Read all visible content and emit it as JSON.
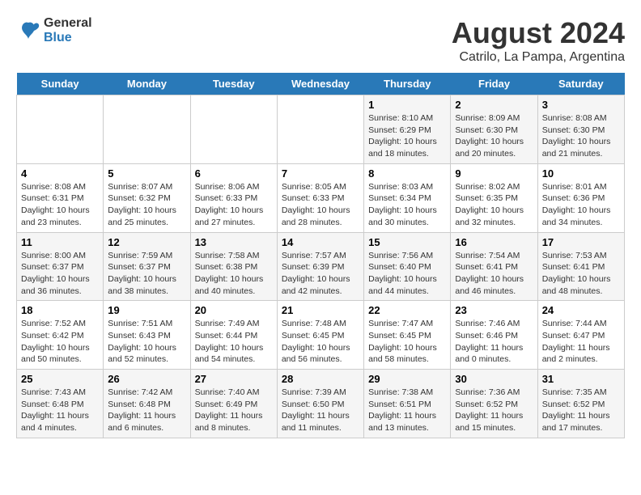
{
  "header": {
    "logo_line1": "General",
    "logo_line2": "Blue",
    "main_title": "August 2024",
    "subtitle": "Catrilo, La Pampa, Argentina"
  },
  "days_of_week": [
    "Sunday",
    "Monday",
    "Tuesday",
    "Wednesday",
    "Thursday",
    "Friday",
    "Saturday"
  ],
  "weeks": [
    [
      {
        "day": "",
        "info": ""
      },
      {
        "day": "",
        "info": ""
      },
      {
        "day": "",
        "info": ""
      },
      {
        "day": "",
        "info": ""
      },
      {
        "day": "1",
        "info": "Sunrise: 8:10 AM\nSunset: 6:29 PM\nDaylight: 10 hours\nand 18 minutes."
      },
      {
        "day": "2",
        "info": "Sunrise: 8:09 AM\nSunset: 6:30 PM\nDaylight: 10 hours\nand 20 minutes."
      },
      {
        "day": "3",
        "info": "Sunrise: 8:08 AM\nSunset: 6:30 PM\nDaylight: 10 hours\nand 21 minutes."
      }
    ],
    [
      {
        "day": "4",
        "info": "Sunrise: 8:08 AM\nSunset: 6:31 PM\nDaylight: 10 hours\nand 23 minutes."
      },
      {
        "day": "5",
        "info": "Sunrise: 8:07 AM\nSunset: 6:32 PM\nDaylight: 10 hours\nand 25 minutes."
      },
      {
        "day": "6",
        "info": "Sunrise: 8:06 AM\nSunset: 6:33 PM\nDaylight: 10 hours\nand 27 minutes."
      },
      {
        "day": "7",
        "info": "Sunrise: 8:05 AM\nSunset: 6:33 PM\nDaylight: 10 hours\nand 28 minutes."
      },
      {
        "day": "8",
        "info": "Sunrise: 8:03 AM\nSunset: 6:34 PM\nDaylight: 10 hours\nand 30 minutes."
      },
      {
        "day": "9",
        "info": "Sunrise: 8:02 AM\nSunset: 6:35 PM\nDaylight: 10 hours\nand 32 minutes."
      },
      {
        "day": "10",
        "info": "Sunrise: 8:01 AM\nSunset: 6:36 PM\nDaylight: 10 hours\nand 34 minutes."
      }
    ],
    [
      {
        "day": "11",
        "info": "Sunrise: 8:00 AM\nSunset: 6:37 PM\nDaylight: 10 hours\nand 36 minutes."
      },
      {
        "day": "12",
        "info": "Sunrise: 7:59 AM\nSunset: 6:37 PM\nDaylight: 10 hours\nand 38 minutes."
      },
      {
        "day": "13",
        "info": "Sunrise: 7:58 AM\nSunset: 6:38 PM\nDaylight: 10 hours\nand 40 minutes."
      },
      {
        "day": "14",
        "info": "Sunrise: 7:57 AM\nSunset: 6:39 PM\nDaylight: 10 hours\nand 42 minutes."
      },
      {
        "day": "15",
        "info": "Sunrise: 7:56 AM\nSunset: 6:40 PM\nDaylight: 10 hours\nand 44 minutes."
      },
      {
        "day": "16",
        "info": "Sunrise: 7:54 AM\nSunset: 6:41 PM\nDaylight: 10 hours\nand 46 minutes."
      },
      {
        "day": "17",
        "info": "Sunrise: 7:53 AM\nSunset: 6:41 PM\nDaylight: 10 hours\nand 48 minutes."
      }
    ],
    [
      {
        "day": "18",
        "info": "Sunrise: 7:52 AM\nSunset: 6:42 PM\nDaylight: 10 hours\nand 50 minutes."
      },
      {
        "day": "19",
        "info": "Sunrise: 7:51 AM\nSunset: 6:43 PM\nDaylight: 10 hours\nand 52 minutes."
      },
      {
        "day": "20",
        "info": "Sunrise: 7:49 AM\nSunset: 6:44 PM\nDaylight: 10 hours\nand 54 minutes."
      },
      {
        "day": "21",
        "info": "Sunrise: 7:48 AM\nSunset: 6:45 PM\nDaylight: 10 hours\nand 56 minutes."
      },
      {
        "day": "22",
        "info": "Sunrise: 7:47 AM\nSunset: 6:45 PM\nDaylight: 10 hours\nand 58 minutes."
      },
      {
        "day": "23",
        "info": "Sunrise: 7:46 AM\nSunset: 6:46 PM\nDaylight: 11 hours\nand 0 minutes."
      },
      {
        "day": "24",
        "info": "Sunrise: 7:44 AM\nSunset: 6:47 PM\nDaylight: 11 hours\nand 2 minutes."
      }
    ],
    [
      {
        "day": "25",
        "info": "Sunrise: 7:43 AM\nSunset: 6:48 PM\nDaylight: 11 hours\nand 4 minutes."
      },
      {
        "day": "26",
        "info": "Sunrise: 7:42 AM\nSunset: 6:48 PM\nDaylight: 11 hours\nand 6 minutes."
      },
      {
        "day": "27",
        "info": "Sunrise: 7:40 AM\nSunset: 6:49 PM\nDaylight: 11 hours\nand 8 minutes."
      },
      {
        "day": "28",
        "info": "Sunrise: 7:39 AM\nSunset: 6:50 PM\nDaylight: 11 hours\nand 11 minutes."
      },
      {
        "day": "29",
        "info": "Sunrise: 7:38 AM\nSunset: 6:51 PM\nDaylight: 11 hours\nand 13 minutes."
      },
      {
        "day": "30",
        "info": "Sunrise: 7:36 AM\nSunset: 6:52 PM\nDaylight: 11 hours\nand 15 minutes."
      },
      {
        "day": "31",
        "info": "Sunrise: 7:35 AM\nSunset: 6:52 PM\nDaylight: 11 hours\nand 17 minutes."
      }
    ]
  ]
}
